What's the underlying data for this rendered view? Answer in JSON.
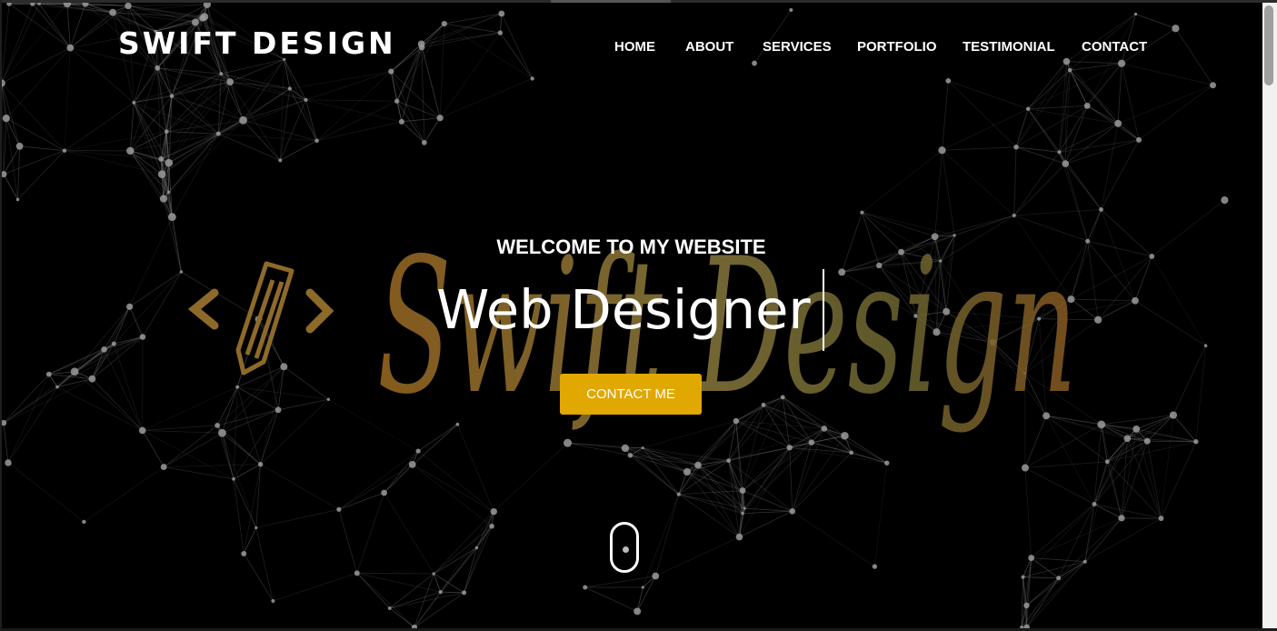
{
  "header": {
    "logo_text": "SWIFT DESIGN",
    "nav": [
      "HOME",
      "ABOUT",
      "SERVICES",
      "PORTFOLIO",
      "TESTIMONIAL",
      "CONTACT"
    ]
  },
  "hero": {
    "kicker": "WELCOME TO MY WEBSITE",
    "title": "Web Designer",
    "cta_label": "CONTACT ME",
    "watermark_text": "Swift Design"
  },
  "colors": {
    "background": "#000000",
    "accent": "#e0a800",
    "watermark": "#8a6a2c",
    "text": "#ffffff"
  },
  "icons": [
    "code-brackets-icon",
    "pencil-icon",
    "scroll-mouse-icon"
  ]
}
